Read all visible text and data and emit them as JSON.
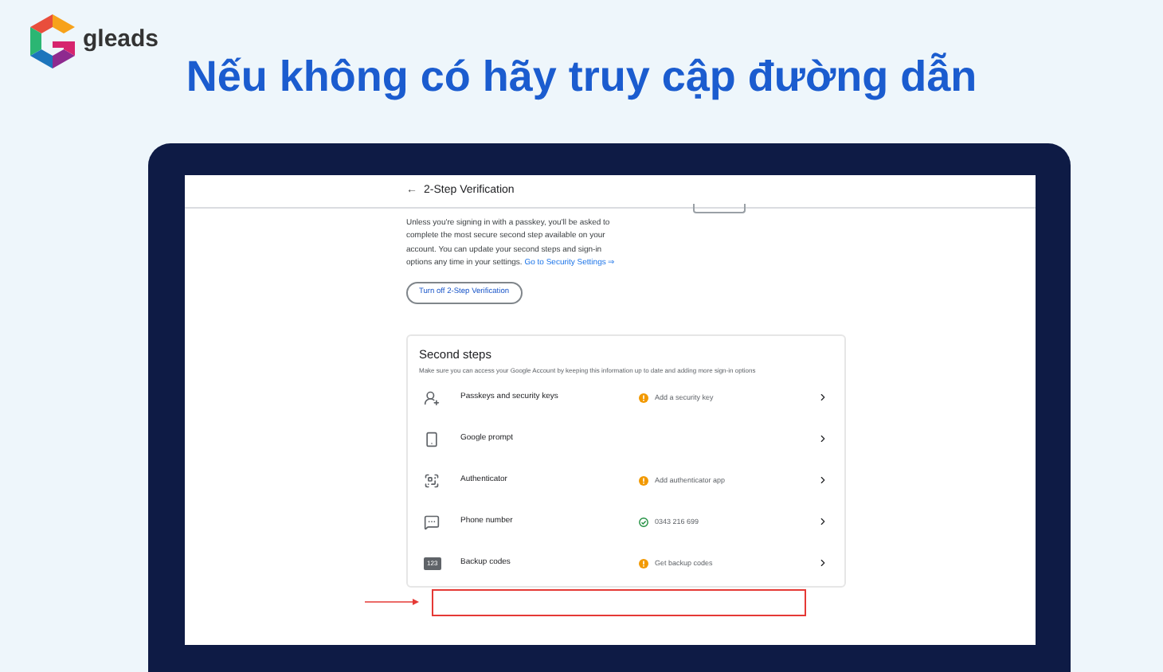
{
  "brand": {
    "name": "gleads"
  },
  "headline": "Nếu không có hãy truy cập đường dẫn",
  "screen": {
    "header": {
      "back": "←",
      "title": "2-Step Verification"
    },
    "intro": {
      "text": "Unless you're signing in with a passkey, you'll be asked to complete the most secure second step available on your account. You can update your second steps and sign-in options any time in your settings.",
      "link": "Go to Security Settings ⇒"
    },
    "turn_off_button": "Turn off 2-Step Verification",
    "second_steps": {
      "title": "Second steps",
      "subtitle": "Make sure you can access your Google Account by keeping this information up to date and adding more sign-in options",
      "rows": [
        {
          "kind": "passkey",
          "label": "Passkeys and security keys",
          "verified": false,
          "detail": "Add a security key"
        },
        {
          "kind": "prompt",
          "label": "Google prompt"
        },
        {
          "kind": "authenticator",
          "label": "Authenticator",
          "verified": false,
          "detail": "Add authenticator app"
        },
        {
          "kind": "phone",
          "label": "Phone number",
          "verified": true,
          "detail": "0343 216 699"
        },
        {
          "kind": "codes",
          "label": "Backup codes",
          "icon_label": "123",
          "verified": false,
          "detail": "Get backup codes"
        }
      ]
    }
  }
}
